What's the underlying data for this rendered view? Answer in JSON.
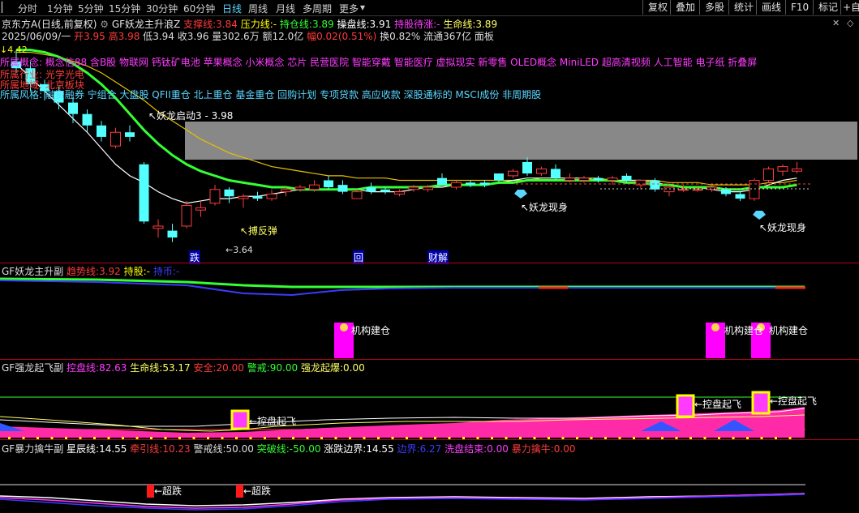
{
  "toolbar": {
    "periods": [
      "分时",
      "1分钟",
      "5分钟",
      "15分钟",
      "30分钟",
      "60分钟",
      "日线",
      "周线",
      "月线",
      "多周期",
      "更多"
    ],
    "active_period": "日线",
    "right_buttons": [
      "复权",
      "叠加",
      "多股",
      "统计",
      "画线",
      "F10",
      "标记",
      "+自"
    ]
  },
  "header": {
    "stock_name": "京东方A",
    "mode": "(日线,前复权)",
    "indicator": "GF妖龙主升浪Z",
    "support_label": "支撑线:",
    "support_value": "3.84",
    "pressure_label": "压力线:",
    "pressure_value": "-",
    "hold_label": "持仓线:",
    "hold_value": "3.89",
    "trade_label": "操盘线:",
    "trade_value": "3.91",
    "wait_label": "持股待涨:",
    "wait_value": "-",
    "life_label": "生命线:",
    "life_value": "3.89"
  },
  "quote": {
    "date": "2025/06/09/一",
    "open_label": "开",
    "open": "3.95",
    "high_label": "高",
    "high": "3.98",
    "low_label": "低",
    "low": "3.94",
    "close_label": "收",
    "close": "3.96",
    "volume_label": "量",
    "volume": "302.6万",
    "amount_label": "额",
    "amount": "12.0亿",
    "change_label": "幅",
    "change": "0.02(0.51%)",
    "turnover_label": "换",
    "turnover": "0.82%",
    "float_label": "流通",
    "float": "367亿",
    "board": "面板"
  },
  "concepts": {
    "partial_left": "↓4.42",
    "line1": "所属概念: 概念信88  含B股 物联网 钙钛矿电池 苹果概念 小米概念 芯片 民营医院 智能穿戴 智能医疗 虚拟现实 新零售 OLED概念 MiniLED 超高清视频 人工智能 电子纸 折叠屏",
    "line2": "所属行业: 光学光电",
    "line3": "所属地域: 北京板块",
    "line4": "所属风格: 融资融券 宁组合 大盘股 QFII重仓 北上重仓 基金重仓 回购计划 专项贷款 高应收款 深股通标的 MSCI成份 非周期股"
  },
  "main_annotations": {
    "yaolong_qidong": "↖妖龙启动3 - 3.98",
    "qiangfantan": "↖搏反弹",
    "low_price": "←3.64",
    "yaolong_1": "↖妖龙现身",
    "yaolong_2": "↖妖龙现身",
    "marker_die": "跌",
    "marker_hui": "回",
    "marker_caijie": "财解"
  },
  "panel1": {
    "title": "GF妖龙主升副",
    "trend_label": "趋势线:",
    "trend_value": "3.92",
    "hold_label": "持股:",
    "hold_value": "-",
    "empty_label": "持币:",
    "empty_value": "-",
    "tag1": "机构建仓",
    "tag2": "机构建仓",
    "tag3": "机构建仓"
  },
  "panel2": {
    "title": "GF强龙起飞副",
    "control_label": "控盘线:",
    "control_value": "82.63",
    "life_label": "生命线:",
    "life_value": "53.17",
    "safe_label": "安全:",
    "safe_value": "20.00",
    "alert_label": "警戒:",
    "alert_value": "90.00",
    "burst_label": "强龙起爆:",
    "burst_value": "0.00",
    "tag1": "←控盘起飞",
    "tag2": "←控盘起飞",
    "tag3": "←控盘起飞"
  },
  "panel3": {
    "title": "GF暴力擒牛副",
    "star_label": "星辰线:",
    "star_value": "14.55",
    "pull_label": "牵引线:",
    "pull_value": "10.23",
    "warn_label": "警戒线:",
    "warn_value": "50.00",
    "break_label": "突破线:",
    "break_value": "-50.00",
    "bound_label": "涨跌边界:",
    "bound_value": "14.55",
    "side_label": "边界:",
    "side_value": "6.27",
    "wash_label": "洗盘结束:",
    "wash_value": "0.00",
    "bull_label": "暴力擒牛:",
    "bull_value": "0.00",
    "tag1": "←超跌",
    "tag2": "←超跌"
  },
  "colors": {
    "up": "#ff3b3b",
    "down": "#54ffff",
    "yellow": "#ffff00",
    "magenta": "#ff00ff",
    "green": "#33ff33",
    "white": "#ffffff",
    "gray_zone": "#888888",
    "separator": "#b3001b"
  },
  "candles": [
    {
      "o": 4.43,
      "h": 4.48,
      "l": 4.38,
      "c": 4.4
    },
    {
      "o": 4.4,
      "h": 4.43,
      "l": 4.3,
      "c": 4.33
    },
    {
      "o": 4.33,
      "h": 4.35,
      "l": 4.26,
      "c": 4.3
    },
    {
      "o": 4.3,
      "h": 4.32,
      "l": 4.22,
      "c": 4.25
    },
    {
      "o": 4.25,
      "h": 4.27,
      "l": 4.16,
      "c": 4.2
    },
    {
      "o": 4.2,
      "h": 4.22,
      "l": 4.12,
      "c": 4.15
    },
    {
      "o": 4.15,
      "h": 4.17,
      "l": 4.08,
      "c": 4.1
    },
    {
      "o": 4.06,
      "h": 4.14,
      "l": 4.05,
      "c": 4.12
    },
    {
      "o": 4.12,
      "h": 4.15,
      "l": 4.08,
      "c": 4.1
    },
    {
      "o": 3.98,
      "h": 3.99,
      "l": 3.72,
      "c": 3.73
    },
    {
      "o": 3.7,
      "h": 3.74,
      "l": 3.66,
      "c": 3.71
    },
    {
      "o": 3.69,
      "h": 3.72,
      "l": 3.64,
      "c": 3.66
    },
    {
      "o": 3.71,
      "h": 3.82,
      "l": 3.7,
      "c": 3.8
    },
    {
      "o": 3.78,
      "h": 3.82,
      "l": 3.75,
      "c": 3.79
    },
    {
      "o": 3.81,
      "h": 3.89,
      "l": 3.8,
      "c": 3.87
    },
    {
      "o": 3.87,
      "h": 3.88,
      "l": 3.81,
      "c": 3.84
    },
    {
      "o": 3.83,
      "h": 3.85,
      "l": 3.79,
      "c": 3.84
    },
    {
      "o": 3.84,
      "h": 3.86,
      "l": 3.82,
      "c": 3.83
    },
    {
      "o": 3.83,
      "h": 3.87,
      "l": 3.82,
      "c": 3.85
    },
    {
      "o": 3.86,
      "h": 3.88,
      "l": 3.84,
      "c": 3.87
    },
    {
      "o": 3.87,
      "h": 3.89,
      "l": 3.86,
      "c": 3.88
    },
    {
      "o": 3.87,
      "h": 3.91,
      "l": 3.86,
      "c": 3.89
    },
    {
      "o": 3.91,
      "h": 3.93,
      "l": 3.87,
      "c": 3.88
    },
    {
      "o": 3.89,
      "h": 3.91,
      "l": 3.85,
      "c": 3.86
    },
    {
      "o": 3.83,
      "h": 3.87,
      "l": 3.83,
      "c": 3.86
    },
    {
      "o": 3.88,
      "h": 3.9,
      "l": 3.85,
      "c": 3.86
    },
    {
      "o": 3.87,
      "h": 3.88,
      "l": 3.85,
      "c": 3.86
    },
    {
      "o": 3.85,
      "h": 3.87,
      "l": 3.84,
      "c": 3.86
    },
    {
      "o": 3.87,
      "h": 3.89,
      "l": 3.86,
      "c": 3.88
    },
    {
      "o": 3.87,
      "h": 3.89,
      "l": 3.86,
      "c": 3.88
    },
    {
      "o": 3.92,
      "h": 3.94,
      "l": 3.89,
      "c": 3.89
    },
    {
      "o": 3.88,
      "h": 3.91,
      "l": 3.87,
      "c": 3.9
    },
    {
      "o": 3.9,
      "h": 3.91,
      "l": 3.88,
      "c": 3.89
    },
    {
      "o": 3.9,
      "h": 3.91,
      "l": 3.88,
      "c": 3.89
    },
    {
      "o": 3.94,
      "h": 3.94,
      "l": 3.9,
      "c": 3.91
    },
    {
      "o": 3.93,
      "h": 3.96,
      "l": 3.92,
      "c": 3.95
    },
    {
      "o": 3.99,
      "h": 4.01,
      "l": 3.93,
      "c": 3.94
    },
    {
      "o": 3.94,
      "h": 3.97,
      "l": 3.93,
      "c": 3.96
    },
    {
      "o": 3.96,
      "h": 3.98,
      "l": 3.91,
      "c": 3.92
    },
    {
      "o": 3.91,
      "h": 3.94,
      "l": 3.9,
      "c": 3.92
    },
    {
      "o": 3.91,
      "h": 3.93,
      "l": 3.9,
      "c": 3.92
    },
    {
      "o": 3.92,
      "h": 3.93,
      "l": 3.9,
      "c": 3.91
    },
    {
      "o": 3.91,
      "h": 3.93,
      "l": 3.89,
      "c": 3.92
    },
    {
      "o": 3.93,
      "h": 3.94,
      "l": 3.9,
      "c": 3.91
    },
    {
      "o": 3.89,
      "h": 3.91,
      "l": 3.87,
      "c": 3.91
    },
    {
      "o": 3.91,
      "h": 3.92,
      "l": 3.86,
      "c": 3.87
    },
    {
      "o": 3.86,
      "h": 3.89,
      "l": 3.84,
      "c": 3.88
    },
    {
      "o": 3.87,
      "h": 3.89,
      "l": 3.86,
      "c": 3.87
    },
    {
      "o": 3.87,
      "h": 3.88,
      "l": 3.86,
      "c": 3.87
    },
    {
      "o": 3.87,
      "h": 3.89,
      "l": 3.86,
      "c": 3.88
    },
    {
      "o": 3.87,
      "h": 3.88,
      "l": 3.84,
      "c": 3.85
    },
    {
      "o": 3.85,
      "h": 3.86,
      "l": 3.82,
      "c": 3.83
    },
    {
      "o": 3.83,
      "h": 3.92,
      "l": 3.82,
      "c": 3.91
    },
    {
      "o": 3.91,
      "h": 3.97,
      "l": 3.9,
      "c": 3.96
    },
    {
      "o": 3.95,
      "h": 3.98,
      "l": 3.93,
      "c": 3.97
    },
    {
      "o": 3.95,
      "h": 3.99,
      "l": 3.94,
      "c": 3.96
    }
  ],
  "ma_white": [
    4.42,
    4.36,
    4.3,
    4.24,
    4.18,
    4.12,
    4.05,
    3.98,
    3.93,
    3.9,
    3.86,
    3.83,
    3.81,
    3.82,
    3.83,
    3.83,
    3.84,
    3.84,
    3.85,
    3.86,
    3.87,
    3.87,
    3.87,
    3.87,
    3.87,
    3.86,
    3.86,
    3.86,
    3.87,
    3.88,
    3.88,
    3.89,
    3.89,
    3.89,
    3.9,
    3.91,
    3.92,
    3.92,
    3.92,
    3.92,
    3.92,
    3.91,
    3.91,
    3.91,
    3.91,
    3.9,
    3.89,
    3.88,
    3.88,
    3.87,
    3.86,
    3.86,
    3.87,
    3.89,
    3.91,
    3.92
  ],
  "ma_yellow": [
    4.47,
    4.47,
    4.46,
    4.45,
    4.43,
    4.41,
    4.38,
    4.34,
    4.3,
    4.26,
    4.21,
    4.17,
    4.13,
    4.09,
    4.06,
    4.03,
    4.01,
    3.99,
    3.97,
    3.96,
    3.95,
    3.94,
    3.93,
    3.93,
    3.92,
    3.92,
    3.92,
    3.91,
    3.91,
    3.91,
    3.91,
    3.91,
    3.91,
    3.91,
    3.91,
    3.91,
    3.91,
    3.92,
    3.92,
    3.92,
    3.92,
    3.92,
    3.91,
    3.91,
    3.91,
    3.91,
    3.9,
    3.9,
    3.9,
    3.89,
    3.89,
    3.89,
    3.89,
    3.9,
    3.9,
    3.91
  ],
  "ma_green": [
    4.48,
    4.48,
    4.47,
    4.45,
    4.42,
    4.38,
    4.33,
    4.27,
    4.2,
    4.13,
    4.07,
    4.02,
    3.98,
    3.95,
    3.93,
    3.91,
    3.9,
    3.89,
    3.88,
    3.88,
    3.87,
    3.87,
    3.87,
    3.87,
    3.87,
    3.88,
    3.88,
    3.88,
    3.88,
    3.88,
    3.89,
    3.89,
    3.89,
    3.89,
    3.9,
    3.9,
    3.91,
    3.91,
    3.91,
    3.91,
    3.91,
    3.91,
    3.91,
    3.9,
    3.9,
    3.89,
    3.89,
    3.88,
    3.88,
    3.88,
    3.87,
    3.87,
    3.88,
    3.88,
    3.88,
    3.89
  ]
}
